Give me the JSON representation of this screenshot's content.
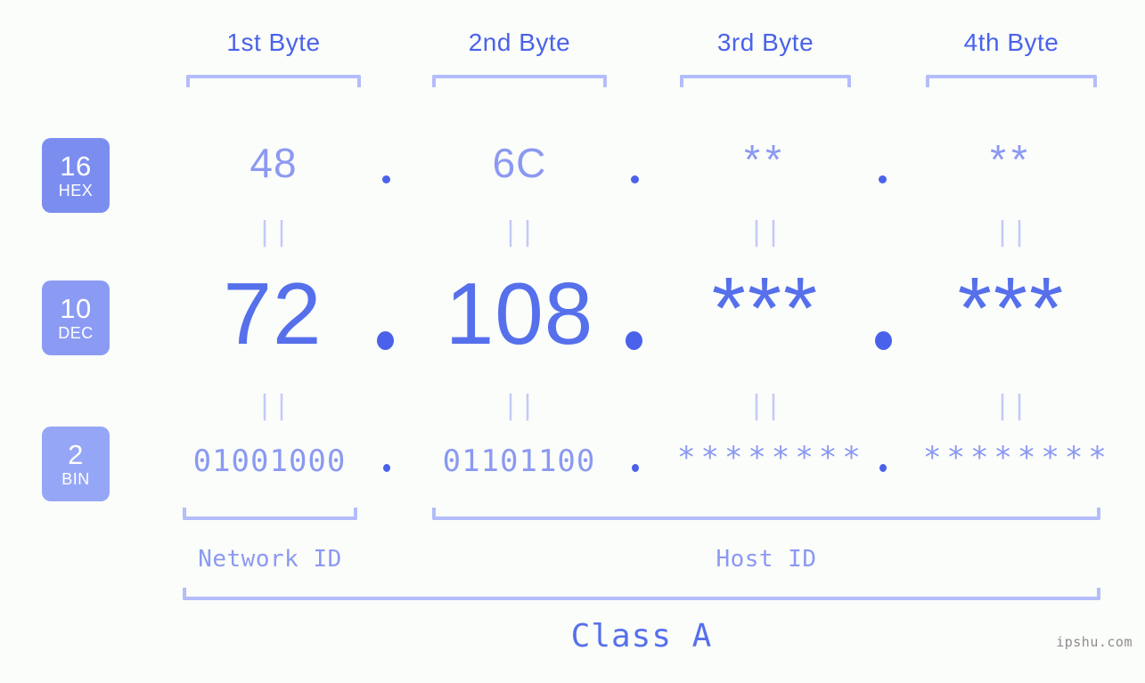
{
  "background_color": "#fbfdfa",
  "accent_colors": {
    "header_blue": "#4a62ea",
    "value_light": "#8b99f2",
    "value_strong": "#5670ec",
    "bracket": "#b4bdfb",
    "equals": "#c3caf9",
    "badge_hex": "#7b8ef0",
    "badge_dec": "#8b9bf3",
    "badge_bin": "#96a6f6",
    "watermark": "#8c8c8c"
  },
  "byte_headers": [
    {
      "label": "1st Byte"
    },
    {
      "label": "2nd Byte"
    },
    {
      "label": "3rd Byte"
    },
    {
      "label": "4th Byte"
    }
  ],
  "base_badges": [
    {
      "number": "16",
      "label": "HEX"
    },
    {
      "number": "10",
      "label": "DEC"
    },
    {
      "number": "2",
      "label": "BIN"
    }
  ],
  "rows": {
    "hex": {
      "base": "16",
      "base_label": "HEX",
      "values": [
        "48",
        "6C",
        "**",
        "**"
      ],
      "separator": "."
    },
    "dec": {
      "base": "10",
      "base_label": "DEC",
      "values": [
        "72",
        "108",
        "***",
        "***"
      ],
      "separator": "."
    },
    "bin": {
      "base": "2",
      "base_label": "BIN",
      "values": [
        "01001000",
        "01101100",
        "********",
        "********"
      ],
      "separator": "."
    }
  },
  "equals_marks": {
    "symbol": "||",
    "count_per_row": 4,
    "rows": 2
  },
  "segments": {
    "network_id": {
      "label": "Network ID"
    },
    "host_id": {
      "label": "Host ID"
    },
    "class": {
      "label": "Class A"
    }
  },
  "watermark": {
    "text": "ipshu.com"
  }
}
